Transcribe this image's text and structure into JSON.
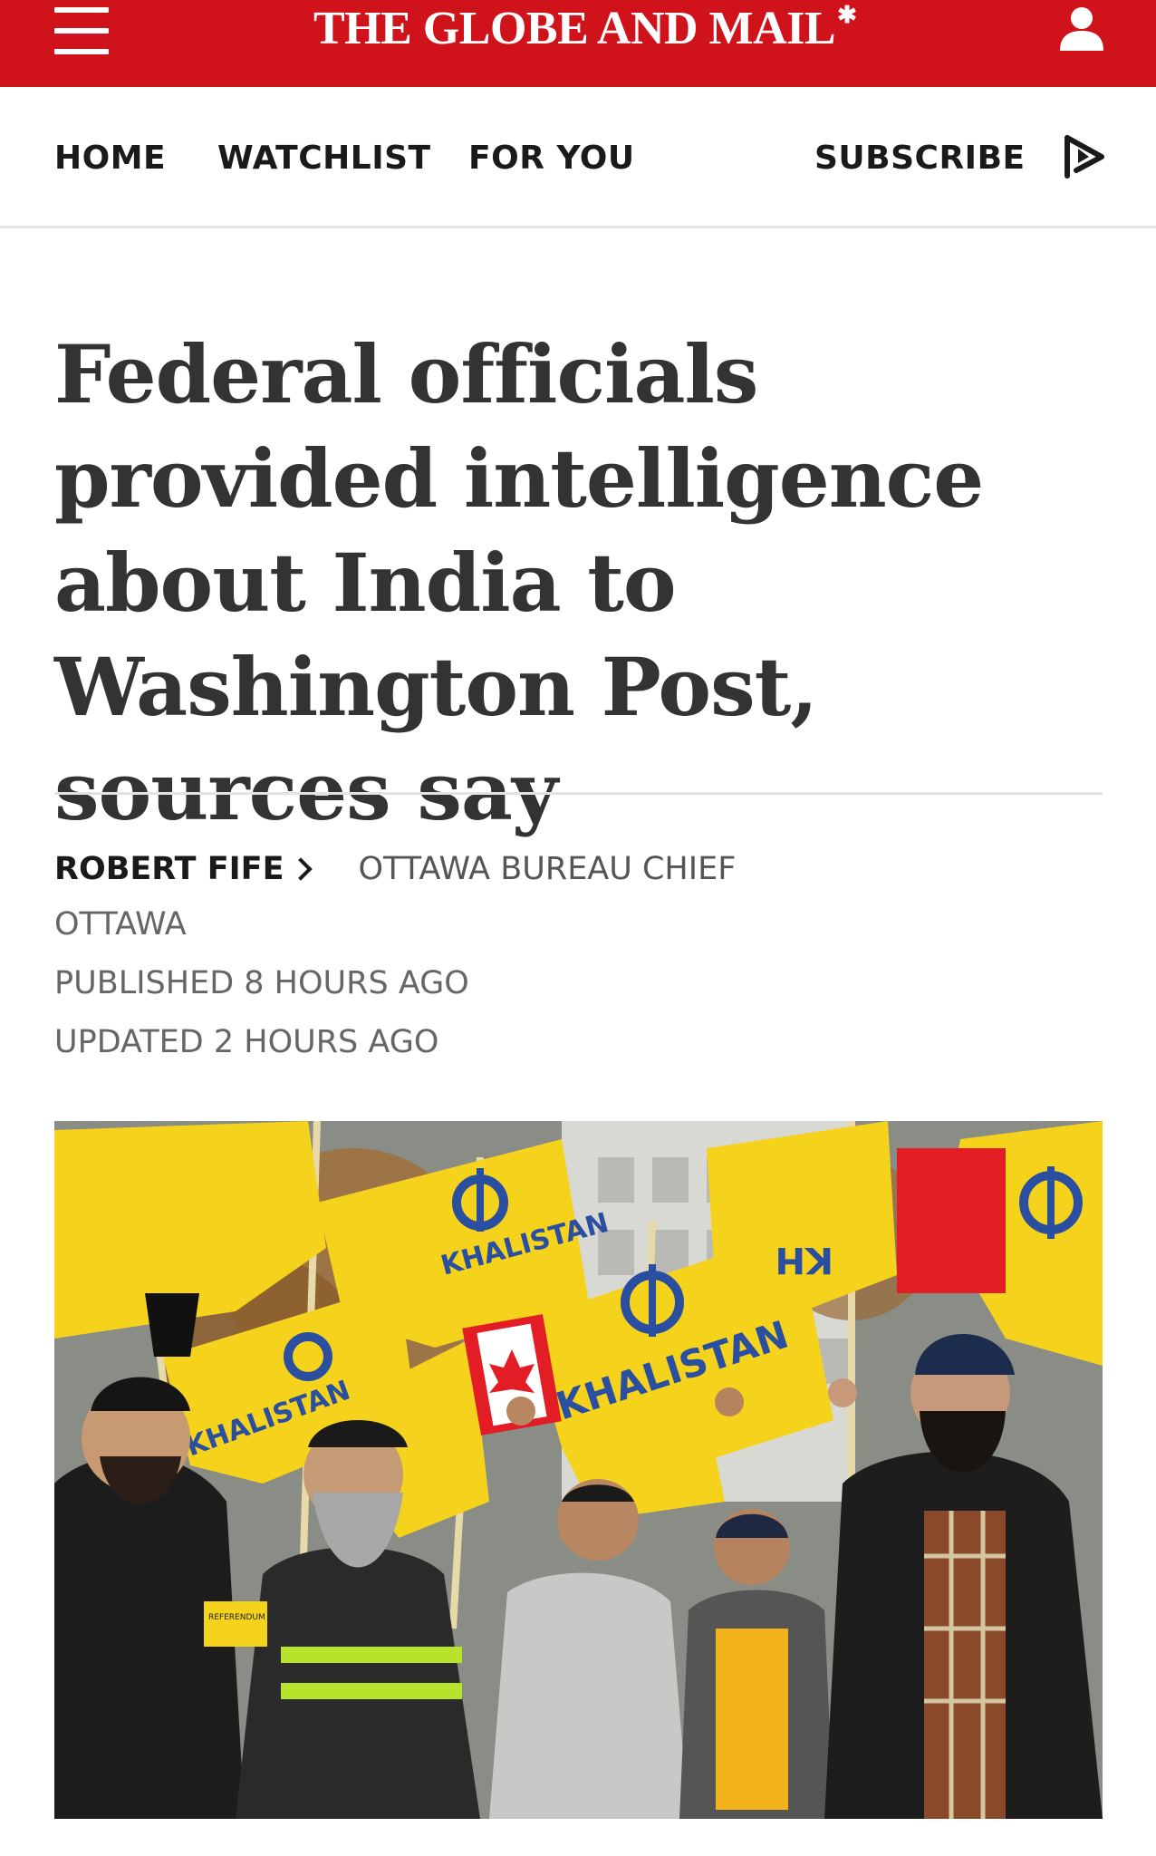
{
  "masthead": {
    "logo_text": "THE GLOBE AND MAIL",
    "background_color": "#d0121b",
    "icons": {
      "menu": "hamburger-menu-icon",
      "account": "account-icon",
      "logo_mark": "maple-leaf-icon"
    }
  },
  "nav": {
    "items": [
      {
        "label": "HOME"
      },
      {
        "label": "WATCHLIST"
      },
      {
        "label": "FOR YOU"
      }
    ],
    "subscribe_label": "SUBSCRIBE",
    "play_icon": "play-video-icon"
  },
  "article": {
    "headline": "Federal officials provided intelligence about India to Washington Post, sources say",
    "author": "ROBERT FIFE",
    "author_role": "OTTAWA BUREAU CHIEF",
    "dateline": "OTTAWA",
    "published": "PUBLISHED 8 HOURS AGO",
    "updated": "UPDATED 2 HOURS AGO",
    "photo": {
      "flag_texts": [
        "KHALISTAN",
        "KH",
        "KHALISTAN",
        "KHALISTAN"
      ],
      "sign_text": "REFERENDUM",
      "flag_color": "#f5d21c",
      "emblem_color": "#2b4fa0"
    }
  }
}
